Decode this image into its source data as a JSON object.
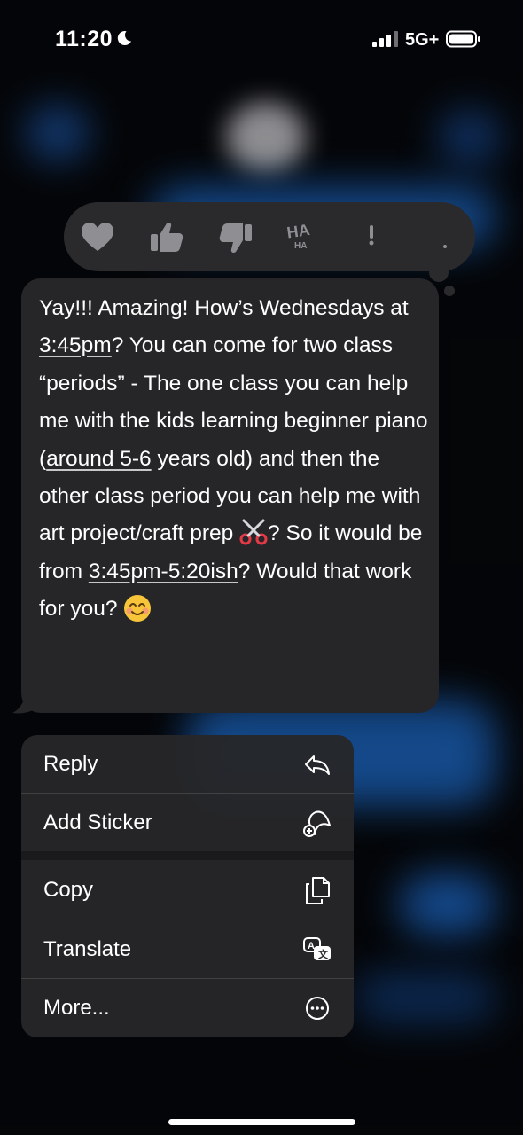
{
  "status_bar": {
    "time": "11:20",
    "network": "5G+",
    "icons": [
      "moon-icon",
      "cellular-signal-icon",
      "battery-icon"
    ]
  },
  "tapback": {
    "reactions": [
      "heart-icon",
      "thumbs-up-icon",
      "thumbs-down-icon",
      "haha-icon",
      "exclamation-icon",
      "question-icon"
    ]
  },
  "message": {
    "part1": "Yay!!! Amazing! How’s Wednesdays at ",
    "time1": "3:45pm",
    "part2": "? You can come for two class “periods” - The one class you can help me with the kids learning beginner piano (",
    "age": "around 5-6",
    "part3": " years old) and then the other class period you can help me with art project/craft prep ",
    "part4": "?  So it would be from ",
    "time2": "3:45pm-5:20ish",
    "part5": "? Would that work for you? ",
    "emojis": [
      "scissors-emoji",
      "smiling-face-emoji"
    ]
  },
  "menu": {
    "items": [
      {
        "label": "Reply",
        "icon": "reply-icon"
      },
      {
        "label": "Add Sticker",
        "icon": "add-sticker-icon"
      },
      {
        "label": "Copy",
        "icon": "copy-icon"
      },
      {
        "label": "Translate",
        "icon": "translate-icon"
      },
      {
        "label": "More...",
        "icon": "more-icon"
      }
    ]
  },
  "colors": {
    "background": "#07090d",
    "bubble": "#262629",
    "menu": "#262629",
    "icon_gray": "#8e8e93",
    "blur_blue": "#1f6fd1"
  }
}
